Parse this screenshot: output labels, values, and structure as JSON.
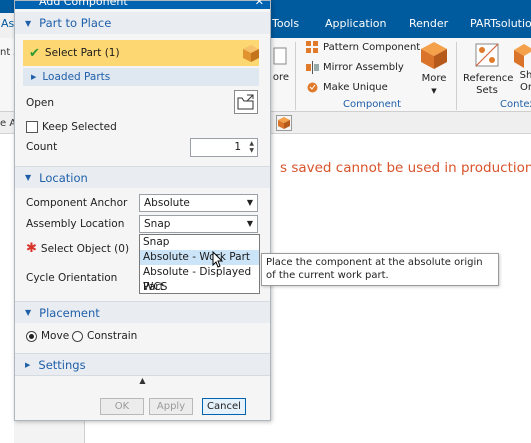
{
  "app": {
    "ribbon_tabs": [
      "As",
      "Tools",
      "Application",
      "Render",
      "PARTsolutions"
    ],
    "component_group": {
      "buttons": [
        "Pattern Component",
        "Mirror Assembly",
        "Make Unique"
      ],
      "more_label": "More",
      "group_label": "Component",
      "partial_left_label": "ore"
    },
    "context_group": {
      "reference_sets_label": "Reference Sets",
      "show_label": "Sh Or",
      "group_label": "Contex"
    },
    "left_strip": [
      "nt A",
      "e A"
    ],
    "warning_text": "s saved cannot be used in production."
  },
  "dialog": {
    "title": "Add Component",
    "close": "✕",
    "part_to_place": {
      "header": "Part to Place",
      "select_part": "Select Part (1)",
      "loaded_parts": "Loaded Parts",
      "open_label": "Open",
      "keep_selected": "Keep Selected",
      "keep_selected_checked": false,
      "count_label": "Count",
      "count_value": "1"
    },
    "location": {
      "header": "Location",
      "component_anchor_label": "Component Anchor",
      "component_anchor_value": "Absolute",
      "assembly_location_label": "Assembly Location",
      "assembly_location_value": "Snap",
      "select_object": "Select Object (0)",
      "cycle_orientation": "Cycle Orientation",
      "dropdown_options": [
        "Snap",
        "Absolute - Work Part",
        "Absolute - Displayed Part",
        "WCS"
      ],
      "highlighted_option": "Absolute - Work Part"
    },
    "placement": {
      "header": "Placement",
      "move": "Move",
      "constrain": "Constrain",
      "selected": "Move"
    },
    "settings": {
      "header": "Settings"
    },
    "buttons": {
      "ok": "OK",
      "apply": "Apply",
      "cancel": "Cancel"
    }
  },
  "tooltip": {
    "text": "Place the component at the absolute origin of the current work part."
  },
  "colors": {
    "title_blue": "#0063b1",
    "ribbon_blue": "#005a9e",
    "section_blue": "#1f5fa8",
    "highlight_yellow": "#fdd772",
    "warning_orange": "#d9532b",
    "dropdown_highlight": "#cce4f7"
  }
}
